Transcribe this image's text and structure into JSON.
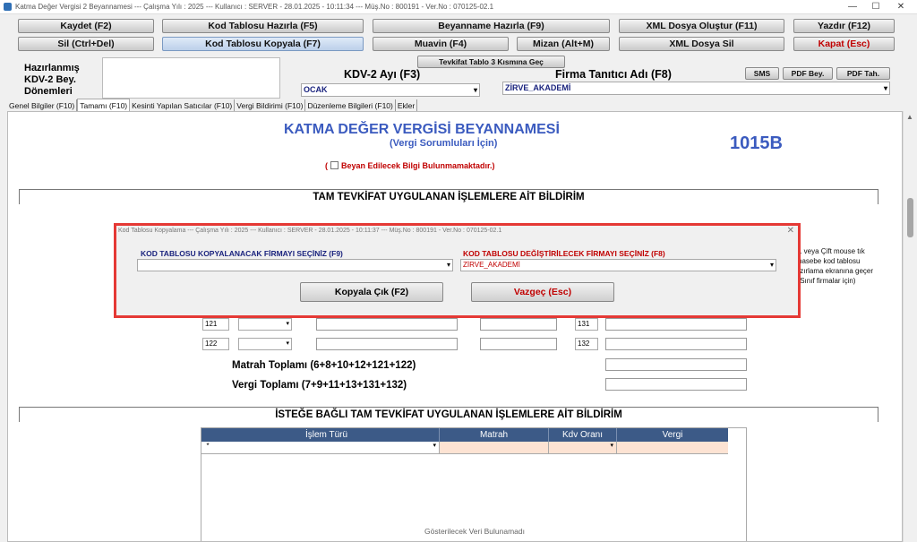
{
  "window": {
    "title": "Katma Değer Vergisi 2 Beyannamesi ---  Çalışma Yılı : 2025  ---  Kullanıcı : SERVER - 28.01.2025 - 10:11:34 --- Müş.No : 800191 - Ver.No : 070125-02.1",
    "minimize": "—",
    "maximize": "☐",
    "close": "✕"
  },
  "toolbar": {
    "kaydet": "Kaydet (F2)",
    "kod_tablosu_hazirla": "Kod Tablosu Hazırla (F5)",
    "beyanname_hazirla": "Beyanname Hazırla (F9)",
    "xml_dosya_olustur": "XML Dosya Oluştur (F11)",
    "yazdir": "Yazdır (F12)",
    "sil": "Sil (Ctrl+Del)",
    "kod_tablosu_kopyala": "Kod Tablosu Kopyala (F7)",
    "muavin": "Muavin (F4)",
    "mizan": "Mizan (Alt+M)",
    "xml_dosya_sil": "XML Dosya Sil",
    "kapat": "Kapat (Esc)",
    "tevkifat": "Tevkifat Tablo 3 Kısmına Geç",
    "sms": "SMS",
    "pdf_bey": "PDF Bey.",
    "pdf_tah": "PDF Tah."
  },
  "header": {
    "hazirlanmis_line1": "Hazırlanmış",
    "hazirlanmis_line2": "KDV-2 Bey.",
    "hazirlanmis_line3": "Dönemleri",
    "kdv_ay_label": "KDV-2 Ayı (F3)",
    "kdv_ay_value": "OCAK",
    "firma_label": "Firma Tanıtıcı Adı (F8)",
    "firma_value": "ZİRVE_AKADEMİ"
  },
  "tabs": [
    "Genel Bilgiler (F10)",
    "Tamamı (F10)",
    "Kesinti Yapılan Satıcılar (F10)",
    "Vergi Bildirimi (F10)",
    "Düzenleme Bilgileri (F10)",
    "Ekler"
  ],
  "form": {
    "title": "KATMA  DEĞER VERGİSİ BEYANNAMESİ",
    "subtitle": "(Vergi Sorumluları İçin)",
    "code": "1015B",
    "no_declaration_open": "(",
    "no_declaration": "Beyan Edilecek Bilgi Bulunmamaktadır.)",
    "section1": "TAM TEVKİFAT UYGULANAN İŞLEMLERE AİT BİLDİRİM",
    "row121": "121",
    "row122": "122",
    "row131": "131",
    "row132": "132",
    "matrah_toplami": "Matrah Toplamı (6+8+10+12+121+122)",
    "vergi_toplami": "Vergi Toplamı (7+9+11+13+131+132)",
    "section2": "İSTEĞE BAĞLI TAM TEVKİFAT UYGULANAN İŞLEMLERE AİT BİLDİRİM",
    "side_hint1": "1 veya Çift mouse tık",
    "side_hint2": "hasebe kod tablosu",
    "side_hint3": "ızırlama ekranına geçer",
    "side_hint4": ".Sınıf firmalar için)"
  },
  "grid": {
    "columns": [
      "İşlem Türü",
      "Matrah",
      "Kdv Oranı",
      "Vergi"
    ],
    "row_marker": "*",
    "empty_text": "Gösterilecek Veri Bulunamadı"
  },
  "dialog": {
    "title": "Kod Tablosu Kopyalama  ---  Çalışma Yılı : 2025  ---  Kullanıcı : SERVER - 28.01.2025 - 10:11:37 --- Müş.No : 800191 - Ver.No : 070125-02.1",
    "close": "✕",
    "source_label": "KOD TABLOSU KOPYALANACAK FİRMAYI SEÇİNİZ (F9)",
    "source_value": "",
    "target_label": "KOD TABLOSU DEĞİŞTİRİLECEK FİRMAYI SEÇİNİZ (F8)",
    "target_value": "ZİRVE_AKADEMİ",
    "copy_button": "Kopyala Çık (F2)",
    "cancel_button": "Vazgeç (Esc)"
  },
  "colors": {
    "accent_blue": "#3b5bbf",
    "warning_red": "#c00000",
    "dialog_border": "#e53935",
    "grid_header": "#3c5a87",
    "grid_row": "#fde3d3"
  }
}
